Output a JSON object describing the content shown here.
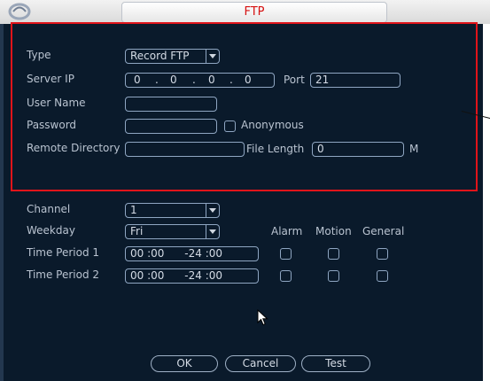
{
  "title": "FTP",
  "ftp": {
    "type_label": "Type",
    "type_value": "Record FTP",
    "server_ip_label": "Server IP",
    "ip_octets": [
      "0",
      "0",
      "0",
      "0"
    ],
    "ip_sep": ".",
    "port_label": "Port",
    "port_value": "21",
    "user_name_label": "User Name",
    "user_name_value": "",
    "password_label": "Password",
    "password_value": "",
    "anonymous_label": "Anonymous",
    "anonymous_checked": false,
    "remote_dir_label": "Remote Directory",
    "remote_dir_value": "",
    "file_length_label": "File Length",
    "file_length_value": "0",
    "file_length_unit": "M"
  },
  "schedule": {
    "channel_label": "Channel",
    "channel_value": "1",
    "weekday_label": "Weekday",
    "weekday_value": "Fri",
    "col_alarm": "Alarm",
    "col_motion": "Motion",
    "col_general": "General",
    "periods": [
      {
        "label": "Time Period 1",
        "value": "00 :00      -24 :00",
        "alarm": false,
        "motion": false,
        "general": false
      },
      {
        "label": "Time Period 2",
        "value": "00 :00      -24 :00",
        "alarm": false,
        "motion": false,
        "general": false
      }
    ]
  },
  "buttons": {
    "ok": "OK",
    "cancel": "Cancel",
    "test": "Test"
  },
  "icons": {
    "logo": "logo-icon",
    "dropdown": "chevron-down-icon",
    "cursor": "mouse-cursor-icon"
  }
}
